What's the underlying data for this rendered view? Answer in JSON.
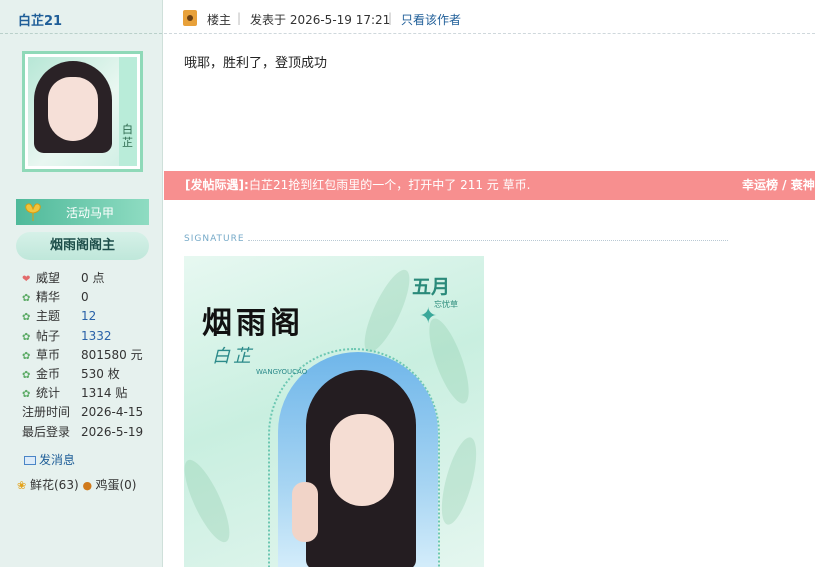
{
  "sidebar": {
    "username": "白芷21",
    "avatar_text": "白芷",
    "badges": {
      "activity": "活动马甲",
      "rank": "烟雨阁阁主"
    },
    "stats": [
      {
        "label": "威望",
        "value": "0 点",
        "icon": "heart-icon"
      },
      {
        "label": "精华",
        "value": "0",
        "icon": "leaf-icon"
      },
      {
        "label": "主题",
        "value": "12",
        "icon": "leaf-icon",
        "link": true
      },
      {
        "label": "帖子",
        "value": "1332",
        "icon": "leaf-icon",
        "link": true
      },
      {
        "label": "草币",
        "value": "801580 元",
        "icon": "leaf-icon"
      },
      {
        "label": "金币",
        "value": "530 枚",
        "icon": "leaf-icon"
      },
      {
        "label": "统计",
        "value": "1314 贴",
        "icon": "leaf-icon"
      },
      {
        "label": "注册时间",
        "value": "2026-4-15"
      },
      {
        "label": "最后登录",
        "value": "2026-5-19"
      }
    ],
    "send_message": "发消息",
    "gifts": {
      "flowers": "鲜花(63)",
      "eggs": "鸡蛋(0)"
    }
  },
  "post": {
    "floor_label": "楼主",
    "time": "发表于 2026-5-19 17:21",
    "author_only": "只看该作者",
    "content": "哦耶，胜利了，登顶成功",
    "reward": {
      "tag": "[发帖际遇]:",
      "text": "白芷21抢到红包雨里的一个，打开中了 211 元 草币.",
      "right": "幸运榜 / 衰神"
    }
  },
  "signature": {
    "label": "SIGNATURE",
    "title": "烟雨阁",
    "name": "白芷",
    "month": "五月",
    "month_sub": "忘忧草",
    "vertical_text": "WANGYOUCAO"
  }
}
